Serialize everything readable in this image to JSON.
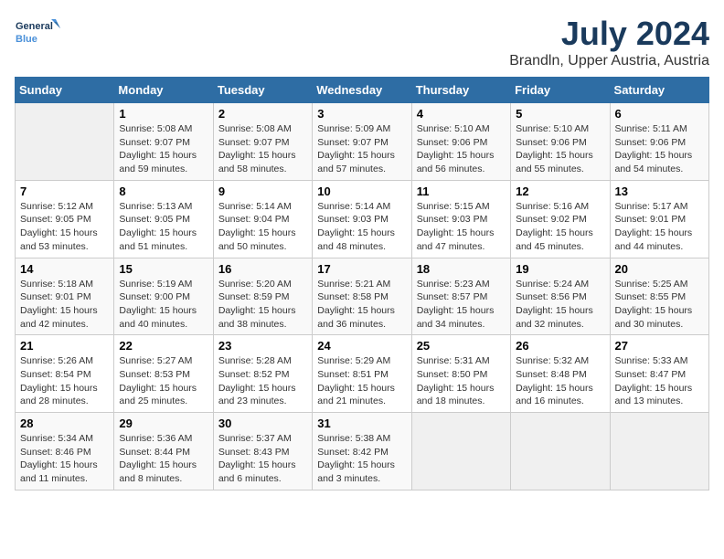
{
  "logo": {
    "line1": "General",
    "line2": "Blue"
  },
  "title": "July 2024",
  "subtitle": "Brandln, Upper Austria, Austria",
  "header_days": [
    "Sunday",
    "Monday",
    "Tuesday",
    "Wednesday",
    "Thursday",
    "Friday",
    "Saturday"
  ],
  "weeks": [
    [
      {
        "day": "",
        "info": ""
      },
      {
        "day": "1",
        "info": "Sunrise: 5:08 AM\nSunset: 9:07 PM\nDaylight: 15 hours\nand 59 minutes."
      },
      {
        "day": "2",
        "info": "Sunrise: 5:08 AM\nSunset: 9:07 PM\nDaylight: 15 hours\nand 58 minutes."
      },
      {
        "day": "3",
        "info": "Sunrise: 5:09 AM\nSunset: 9:07 PM\nDaylight: 15 hours\nand 57 minutes."
      },
      {
        "day": "4",
        "info": "Sunrise: 5:10 AM\nSunset: 9:06 PM\nDaylight: 15 hours\nand 56 minutes."
      },
      {
        "day": "5",
        "info": "Sunrise: 5:10 AM\nSunset: 9:06 PM\nDaylight: 15 hours\nand 55 minutes."
      },
      {
        "day": "6",
        "info": "Sunrise: 5:11 AM\nSunset: 9:06 PM\nDaylight: 15 hours\nand 54 minutes."
      }
    ],
    [
      {
        "day": "7",
        "info": "Sunrise: 5:12 AM\nSunset: 9:05 PM\nDaylight: 15 hours\nand 53 minutes."
      },
      {
        "day": "8",
        "info": "Sunrise: 5:13 AM\nSunset: 9:05 PM\nDaylight: 15 hours\nand 51 minutes."
      },
      {
        "day": "9",
        "info": "Sunrise: 5:14 AM\nSunset: 9:04 PM\nDaylight: 15 hours\nand 50 minutes."
      },
      {
        "day": "10",
        "info": "Sunrise: 5:14 AM\nSunset: 9:03 PM\nDaylight: 15 hours\nand 48 minutes."
      },
      {
        "day": "11",
        "info": "Sunrise: 5:15 AM\nSunset: 9:03 PM\nDaylight: 15 hours\nand 47 minutes."
      },
      {
        "day": "12",
        "info": "Sunrise: 5:16 AM\nSunset: 9:02 PM\nDaylight: 15 hours\nand 45 minutes."
      },
      {
        "day": "13",
        "info": "Sunrise: 5:17 AM\nSunset: 9:01 PM\nDaylight: 15 hours\nand 44 minutes."
      }
    ],
    [
      {
        "day": "14",
        "info": "Sunrise: 5:18 AM\nSunset: 9:01 PM\nDaylight: 15 hours\nand 42 minutes."
      },
      {
        "day": "15",
        "info": "Sunrise: 5:19 AM\nSunset: 9:00 PM\nDaylight: 15 hours\nand 40 minutes."
      },
      {
        "day": "16",
        "info": "Sunrise: 5:20 AM\nSunset: 8:59 PM\nDaylight: 15 hours\nand 38 minutes."
      },
      {
        "day": "17",
        "info": "Sunrise: 5:21 AM\nSunset: 8:58 PM\nDaylight: 15 hours\nand 36 minutes."
      },
      {
        "day": "18",
        "info": "Sunrise: 5:23 AM\nSunset: 8:57 PM\nDaylight: 15 hours\nand 34 minutes."
      },
      {
        "day": "19",
        "info": "Sunrise: 5:24 AM\nSunset: 8:56 PM\nDaylight: 15 hours\nand 32 minutes."
      },
      {
        "day": "20",
        "info": "Sunrise: 5:25 AM\nSunset: 8:55 PM\nDaylight: 15 hours\nand 30 minutes."
      }
    ],
    [
      {
        "day": "21",
        "info": "Sunrise: 5:26 AM\nSunset: 8:54 PM\nDaylight: 15 hours\nand 28 minutes."
      },
      {
        "day": "22",
        "info": "Sunrise: 5:27 AM\nSunset: 8:53 PM\nDaylight: 15 hours\nand 25 minutes."
      },
      {
        "day": "23",
        "info": "Sunrise: 5:28 AM\nSunset: 8:52 PM\nDaylight: 15 hours\nand 23 minutes."
      },
      {
        "day": "24",
        "info": "Sunrise: 5:29 AM\nSunset: 8:51 PM\nDaylight: 15 hours\nand 21 minutes."
      },
      {
        "day": "25",
        "info": "Sunrise: 5:31 AM\nSunset: 8:50 PM\nDaylight: 15 hours\nand 18 minutes."
      },
      {
        "day": "26",
        "info": "Sunrise: 5:32 AM\nSunset: 8:48 PM\nDaylight: 15 hours\nand 16 minutes."
      },
      {
        "day": "27",
        "info": "Sunrise: 5:33 AM\nSunset: 8:47 PM\nDaylight: 15 hours\nand 13 minutes."
      }
    ],
    [
      {
        "day": "28",
        "info": "Sunrise: 5:34 AM\nSunset: 8:46 PM\nDaylight: 15 hours\nand 11 minutes."
      },
      {
        "day": "29",
        "info": "Sunrise: 5:36 AM\nSunset: 8:44 PM\nDaylight: 15 hours\nand 8 minutes."
      },
      {
        "day": "30",
        "info": "Sunrise: 5:37 AM\nSunset: 8:43 PM\nDaylight: 15 hours\nand 6 minutes."
      },
      {
        "day": "31",
        "info": "Sunrise: 5:38 AM\nSunset: 8:42 PM\nDaylight: 15 hours\nand 3 minutes."
      },
      {
        "day": "",
        "info": ""
      },
      {
        "day": "",
        "info": ""
      },
      {
        "day": "",
        "info": ""
      }
    ]
  ]
}
